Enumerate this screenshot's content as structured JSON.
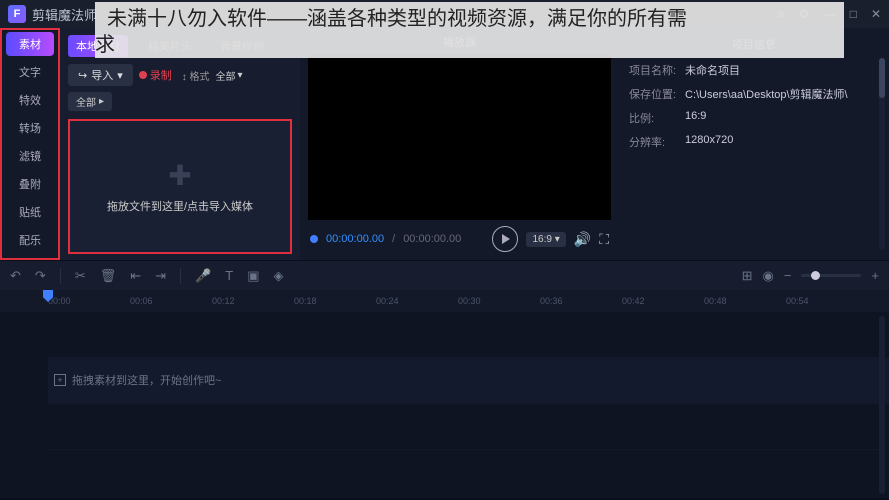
{
  "app": {
    "logo_letter": "F",
    "title": "剪辑魔法师"
  },
  "overlay": {
    "line1": "未满十八勿入软件——涵盖各种类型的视频资源，满足你的所有需",
    "line2": "求"
  },
  "window_controls": {
    "menu": "≡",
    "settings": "⚙",
    "min": "—",
    "max": "□",
    "close": "✕"
  },
  "left_nav": [
    {
      "label": "素材",
      "active": true
    },
    {
      "label": "文字",
      "active": false
    },
    {
      "label": "特效",
      "active": false
    },
    {
      "label": "转场",
      "active": false
    },
    {
      "label": "滤镜",
      "active": false
    },
    {
      "label": "叠附",
      "active": false
    },
    {
      "label": "贴纸",
      "active": false
    },
    {
      "label": "配乐",
      "active": false
    }
  ],
  "material": {
    "tabs": [
      {
        "label": "本地素材",
        "active": true
      },
      {
        "label": "精美片头",
        "active": false
      },
      {
        "label": "背景样例",
        "active": false
      }
    ],
    "import_label": "导入",
    "record_label": "录制",
    "format_label": "格式",
    "format_value": "全部",
    "filter_all": "全部",
    "dropzone_text": "拖放文件到这里/点击导入媒体"
  },
  "player": {
    "title": "播放器",
    "current_time": "00:00:00.00",
    "duration": "00:00:00.00",
    "aspect": "16:9"
  },
  "project_info": {
    "title": "项目信息",
    "rows": [
      {
        "label": "项目名称:",
        "value": "未命名项目"
      },
      {
        "label": "保存位置:",
        "value": "C:\\Users\\aa\\Desktop\\剪辑魔法师\\"
      },
      {
        "label": "比例:",
        "value": "16:9"
      },
      {
        "label": "分辨率:",
        "value": "1280x720"
      }
    ]
  },
  "timeline": {
    "ruler_marks": [
      "00:00",
      "00:06",
      "00:12",
      "00:18",
      "00:24",
      "00:30",
      "00:36",
      "00:42",
      "00:48",
      "00:54"
    ],
    "track_placeholder": "拖拽素材到这里，开始创作吧~"
  }
}
